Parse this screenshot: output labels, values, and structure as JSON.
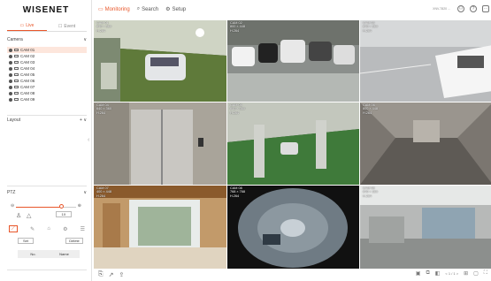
{
  "brand": "WISENET",
  "left_tabs": {
    "live": "Live",
    "event": "Event"
  },
  "camera_section": {
    "title": "Camera",
    "chevron": "∨"
  },
  "cameras": [
    "CAM 01",
    "CAM 02",
    "CAM 03",
    "CAM 04",
    "CAM 05",
    "CAM 06",
    "CAM 07",
    "CAM 08",
    "CAM 09"
  ],
  "layout_section": {
    "title": "Layout",
    "add": "+",
    "chevron": "∨"
  },
  "ptz": {
    "title": "PTZ",
    "chevron": "∨",
    "level": 0.75,
    "speed_value": "1X",
    "set_label": "Set",
    "delete_label": "Delete",
    "no_label": "No.",
    "name_label": "Name"
  },
  "topbar": {
    "monitoring": "Monitoring",
    "search": "Search",
    "setup": "Setup",
    "user": "XNV-7820 ..."
  },
  "tiles": [
    {
      "name": "CAM 01",
      "res": "640 × 360",
      "codec": "H.264"
    },
    {
      "name": "CAM 02",
      "res": "800 × 448",
      "codec": "H.264"
    },
    {
      "name": "CAM 03",
      "res": "640 × 360",
      "codec": "H.264"
    },
    {
      "name": "CAM 04",
      "res": "640 × 360",
      "codec": "H.264"
    },
    {
      "name": "CAM 05",
      "res": "640 × 360",
      "codec": "H.264"
    },
    {
      "name": "CAM 06",
      "res": "800 × 448",
      "codec": "H.264"
    },
    {
      "name": "CAM 07",
      "res": "400 × 448",
      "codec": "H.264"
    },
    {
      "name": "CAM 08",
      "res": "768 × 768",
      "codec": "H.264"
    },
    {
      "name": "CAM 09",
      "res": "640 × 360",
      "codec": "H.264"
    }
  ],
  "pager": "< 1 / 1 >",
  "colors": {
    "accent": "#e8562a"
  }
}
